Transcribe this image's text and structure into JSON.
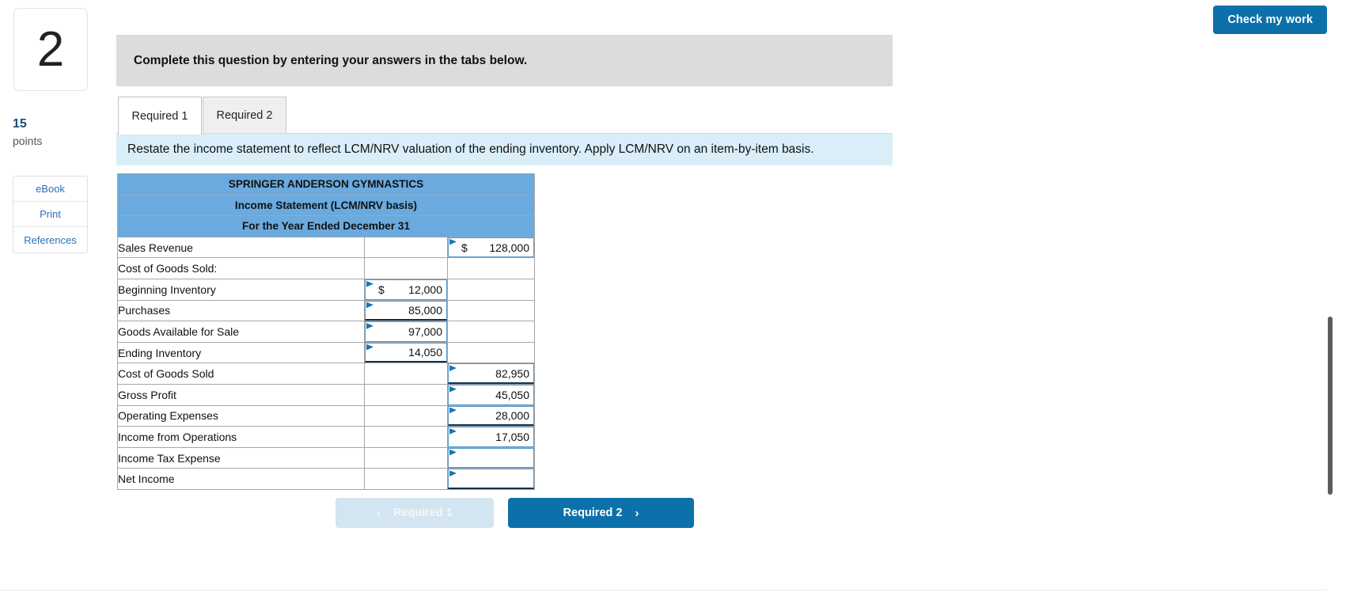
{
  "rail": {
    "question_number": "2",
    "points_value": "15",
    "points_label": "points",
    "tools": [
      {
        "label": "eBook"
      },
      {
        "label": "Print"
      },
      {
        "label": "References"
      }
    ]
  },
  "header": {
    "check_my_work": "Check my work"
  },
  "banner": {
    "text": "Complete this question by entering your answers in the tabs below."
  },
  "tabs": [
    {
      "label": "Required 1",
      "active": true
    },
    {
      "label": "Required 2",
      "active": false
    }
  ],
  "subbanner": {
    "text": "Restate the income statement to reflect LCM/NRV valuation of the ending inventory. Apply LCM/NRV on an item-by-item basis."
  },
  "statement": {
    "title_lines": [
      "SPRINGER ANDERSON GYMNASTICS",
      "Income Statement (LCM/NRV basis)",
      "For the Year Ended December 31"
    ],
    "rows": [
      {
        "label": "Sales Revenue",
        "indent": 0,
        "colA": null,
        "colB": {
          "dollar": "$",
          "value": "128,000",
          "double": false
        }
      },
      {
        "label": "Cost of Goods Sold:",
        "indent": 0,
        "colA": null,
        "colB": null
      },
      {
        "label": "Beginning Inventory",
        "indent": 1,
        "colA": {
          "dollar": "$",
          "value": "12,000",
          "double": false
        },
        "colB": null
      },
      {
        "label": "Purchases",
        "indent": 1,
        "colA": {
          "dollar": "",
          "value": "85,000",
          "double": true
        },
        "colB": null
      },
      {
        "label": "Goods Available for Sale",
        "indent": 2,
        "colA": {
          "dollar": "",
          "value": "97,000",
          "double": false
        },
        "colB": null
      },
      {
        "label": "Ending Inventory",
        "indent": 1,
        "colA": {
          "dollar": "",
          "value": "14,050",
          "double": true
        },
        "colB": null
      },
      {
        "label": "Cost of Goods Sold",
        "indent": 2,
        "colA": null,
        "colB": {
          "dollar": "",
          "value": "82,950",
          "double": true
        }
      },
      {
        "label": "Gross Profit",
        "indent": 0,
        "colA": null,
        "colB": {
          "dollar": "",
          "value": "45,050",
          "double": false
        }
      },
      {
        "label": "Operating Expenses",
        "indent": 0,
        "colA": null,
        "colB": {
          "dollar": "",
          "value": "28,000",
          "double": true
        }
      },
      {
        "label": "Income from Operations",
        "indent": 0,
        "colA": null,
        "colB": {
          "dollar": "",
          "value": "17,050",
          "double": false
        }
      },
      {
        "label": "Income Tax Expense",
        "indent": 0,
        "colA": null,
        "colB": {
          "dollar": "",
          "value": "",
          "double": false
        }
      },
      {
        "label": "Net Income",
        "indent": 0,
        "colA": null,
        "colB": {
          "dollar": "",
          "value": "",
          "double": true
        }
      }
    ]
  },
  "nav": {
    "prev_label": "Required 1",
    "next_label": "Required 2",
    "prev_chevron": "‹",
    "next_chevron": "›"
  },
  "colors": {
    "accent": "#0c71ab",
    "table_header": "#6aaade",
    "subbanner": "#d9eef8",
    "banner": "#dcdcdc",
    "cell_border": "#5596c8"
  }
}
